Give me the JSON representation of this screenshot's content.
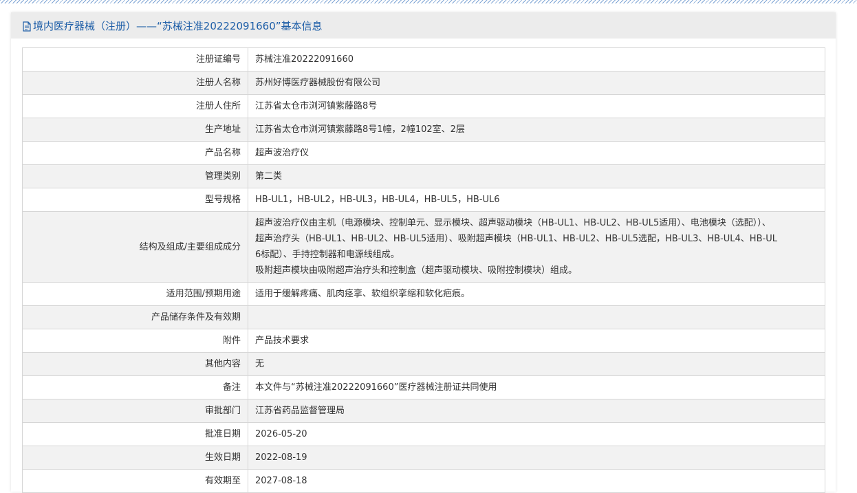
{
  "header": {
    "icon": "document-icon",
    "title": "境内医疗器械（注册）——“苏械注准20222091660”基本信息"
  },
  "rows": [
    {
      "label": "注册证编号",
      "value": "苏械注准20222091660"
    },
    {
      "label": "注册人名称",
      "value": "苏州好博医疗器械股份有限公司"
    },
    {
      "label": "注册人住所",
      "value": "江苏省太仓市浏河镇紫藤路8号"
    },
    {
      "label": "生产地址",
      "value": "江苏省太仓市浏河镇紫藤路8号1幢，2幢102室、2层"
    },
    {
      "label": "产品名称",
      "value": "超声波治疗仪"
    },
    {
      "label": "管理类别",
      "value": "第二类"
    },
    {
      "label": "型号规格",
      "value": "HB-UL1，HB-UL2，HB-UL3，HB-UL4，HB-UL5，HB-UL6"
    },
    {
      "label": "结构及组成/主要组成成分",
      "lines": [
        "超声波治疗仪由主机（电源模块、控制单元、显示模块、超声驱动模块（HB-UL1、HB-UL2、HB-UL5适用）、电池模块（选配））、",
        "超声治疗头（HB-UL1、HB-UL2、HB-UL5适用）、吸附超声模块（HB-UL1、HB-UL2、HB-UL5选配，HB-UL3、HB-UL4、HB-UL",
        "6标配）、手持控制器和电源线组成。",
        "吸附超声模块由吸附超声治疗头和控制盒（超声驱动模块、吸附控制模块）组成。"
      ]
    },
    {
      "label": "适用范围/预期用途",
      "value": "适用于缓解疼痛、肌肉痉挛、软组织挛缩和软化疤痕。"
    },
    {
      "label": "产品储存条件及有效期",
      "value": ""
    },
    {
      "label": "附件",
      "value": "产品技术要求"
    },
    {
      "label": "其他内容",
      "value": "无"
    },
    {
      "label": "备注",
      "value": "本文件与“苏械注准20222091660”医疗器械注册证共同使用"
    },
    {
      "label": "审批部门",
      "value": "江苏省药品监督管理局"
    },
    {
      "label": "批准日期",
      "value": "2026-05-20"
    },
    {
      "label": "生效日期",
      "value": "2022-08-19"
    },
    {
      "label": "有效期至",
      "value": "2027-08-18"
    }
  ]
}
